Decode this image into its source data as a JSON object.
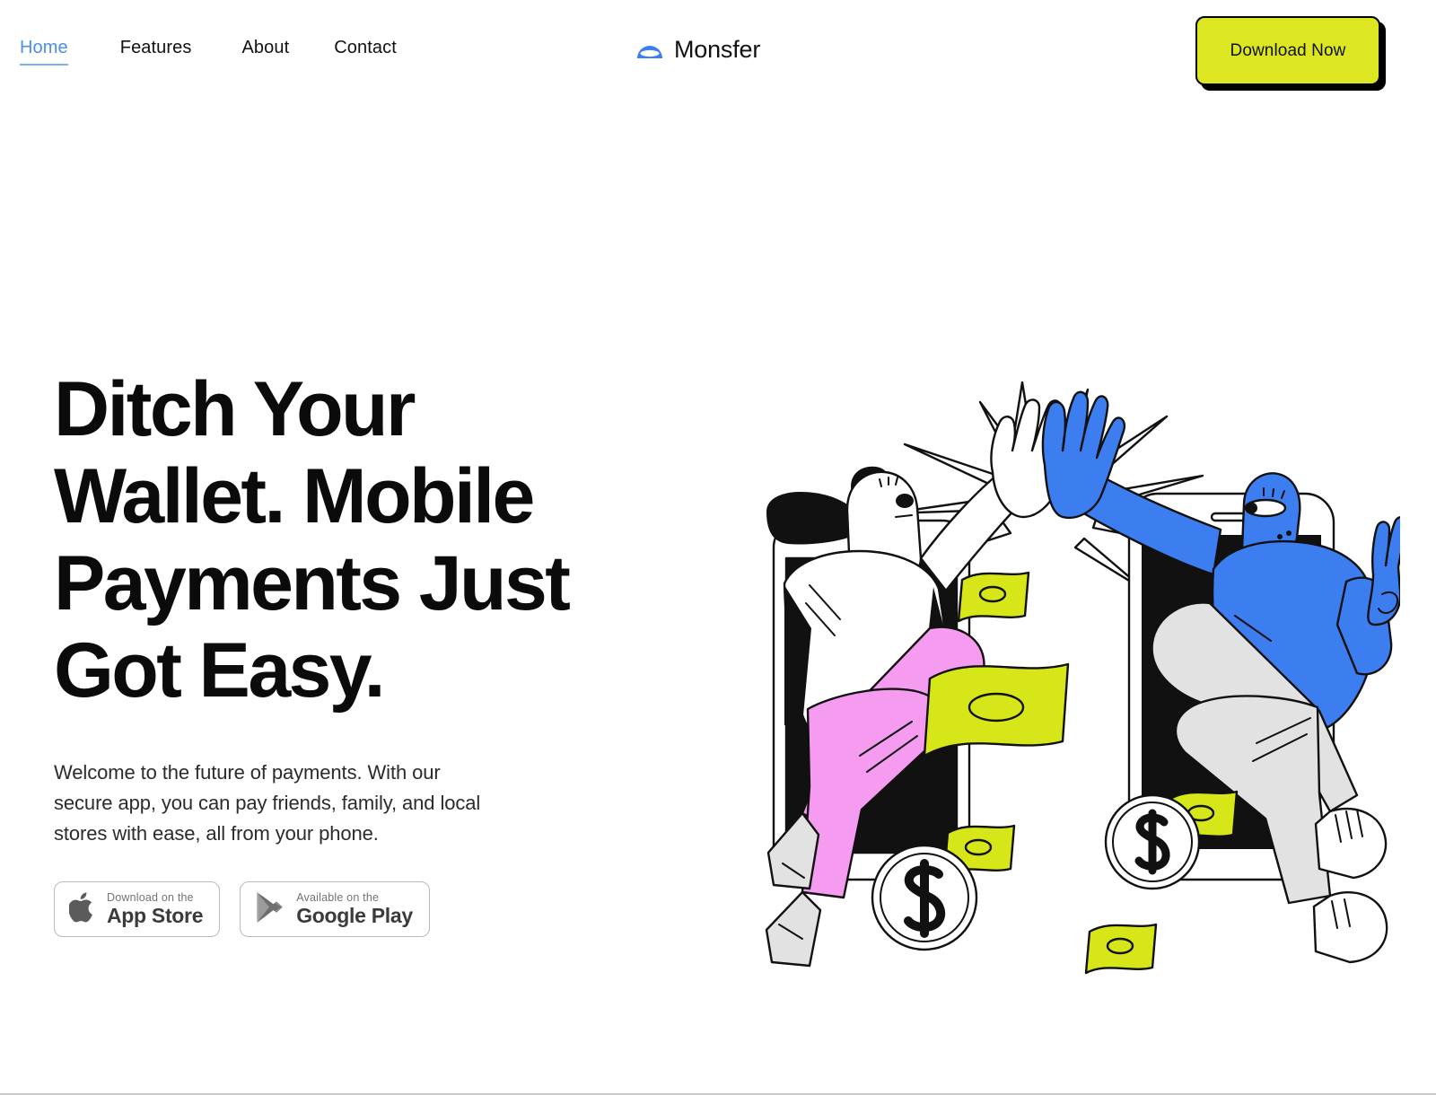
{
  "brand": {
    "name": "Monsfer",
    "logo_icon": "dome-lens-logo-icon",
    "logo_color": "#3c7ef0"
  },
  "nav": {
    "items": [
      {
        "label": "Home",
        "active": true
      },
      {
        "label": "Features",
        "active": false
      },
      {
        "label": "About",
        "active": false
      },
      {
        "label": "Contact",
        "active": false
      }
    ],
    "active_color": "#4a8eea"
  },
  "header": {
    "cta_label": "Download Now",
    "cta_bg": "#dce721",
    "cta_border": "#000000",
    "cta_shadow": "#000000"
  },
  "hero": {
    "title": "Ditch Your Wallet. Mobile Payments Just Got Easy.",
    "subtitle": "Welcome to the future of payments. With our secure app, you can pay friends, family, and local stores with ease, all from your phone.",
    "title_color": "#0b0b0b",
    "subtitle_color": "#2b2b2b"
  },
  "store_badges": [
    {
      "icon": "apple-logo-icon",
      "small_label": "Download on the",
      "big_label": "App Store"
    },
    {
      "icon": "google-play-triangle-icon",
      "small_label": "Available on the",
      "big_label": "Google Play"
    }
  ],
  "illustration": {
    "name": "high-five-mobile-payment-illustration",
    "description": "Two characters emerging from smartphones giving a high five, surrounded by flying cash bills and dollar coins",
    "colors": {
      "blue": "#3c7ef0",
      "pink": "#f59cf0",
      "money_green": "#d6e619",
      "gray": "#e2e2e2",
      "black": "#000000",
      "white": "#ffffff"
    },
    "elements": {
      "phones": 2,
      "characters": 2,
      "bills": 5,
      "coins": 2,
      "burst_rays": 9
    }
  }
}
